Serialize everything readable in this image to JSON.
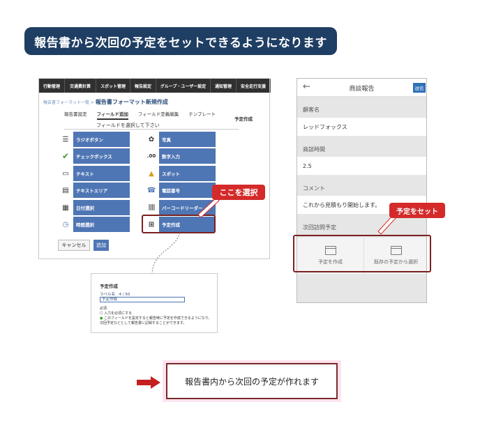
{
  "banner": {
    "title": "報告書から次回の予定をセットできるようになります"
  },
  "desktop": {
    "nav": [
      "行動管理",
      "交通費計算",
      "スポット管理",
      "報告設定",
      "グループ・ユーザー設定",
      "通知管理",
      "安全走行支援"
    ],
    "breadcrumb_link": "報告書フォーマット一覧 >",
    "breadcrumb_current": "報告書フォーマット新規作成",
    "tabs": [
      "報告書設定",
      "フィールド追加",
      "フィールド定義編集",
      "テンプレート"
    ],
    "tab_right": "予定作成",
    "instruction": "フィールドを選択して下さい",
    "fields_left": [
      "ラジオボタン",
      "チェックボックス",
      "テキスト",
      "テキストエリア",
      "日付選択",
      "時間選択"
    ],
    "fields_right": [
      "写真",
      "数字入力",
      "スポット",
      "電話番号",
      "バーコードリーダー",
      "予定作成"
    ],
    "cancel": "キャンセル",
    "add": "追加"
  },
  "callout_left": "ここを選択",
  "popup": {
    "title": "予定作成",
    "label": "ラベル名　4 / 50",
    "input_value": "予定作成",
    "required": "必須",
    "checkbox": "入力を必須にする",
    "note": "このフィールドを設定すると報告時に予定を作成できるようになり、次回予定などとして報告書に記録することができます。"
  },
  "phone": {
    "title": "商談報告",
    "send": "送信",
    "customer_label": "顧客名",
    "customer_value": "レッドフォックス",
    "time_label": "商談時間",
    "time_value": "2.5",
    "comment_label": "コメント",
    "comment_value": "これから見積もり開始します。",
    "next_label": "次回訪問予定",
    "action_create": "予定を作成",
    "action_select": "既存の予定から選択"
  },
  "callout_right": "予定をセット",
  "bottom_message": "報告書内から次回の予定が作れます",
  "colors": {
    "banner": "#1f3e63",
    "field": "#4f76b4",
    "callout": "#d42a2a",
    "highlight": "#7a2020"
  }
}
